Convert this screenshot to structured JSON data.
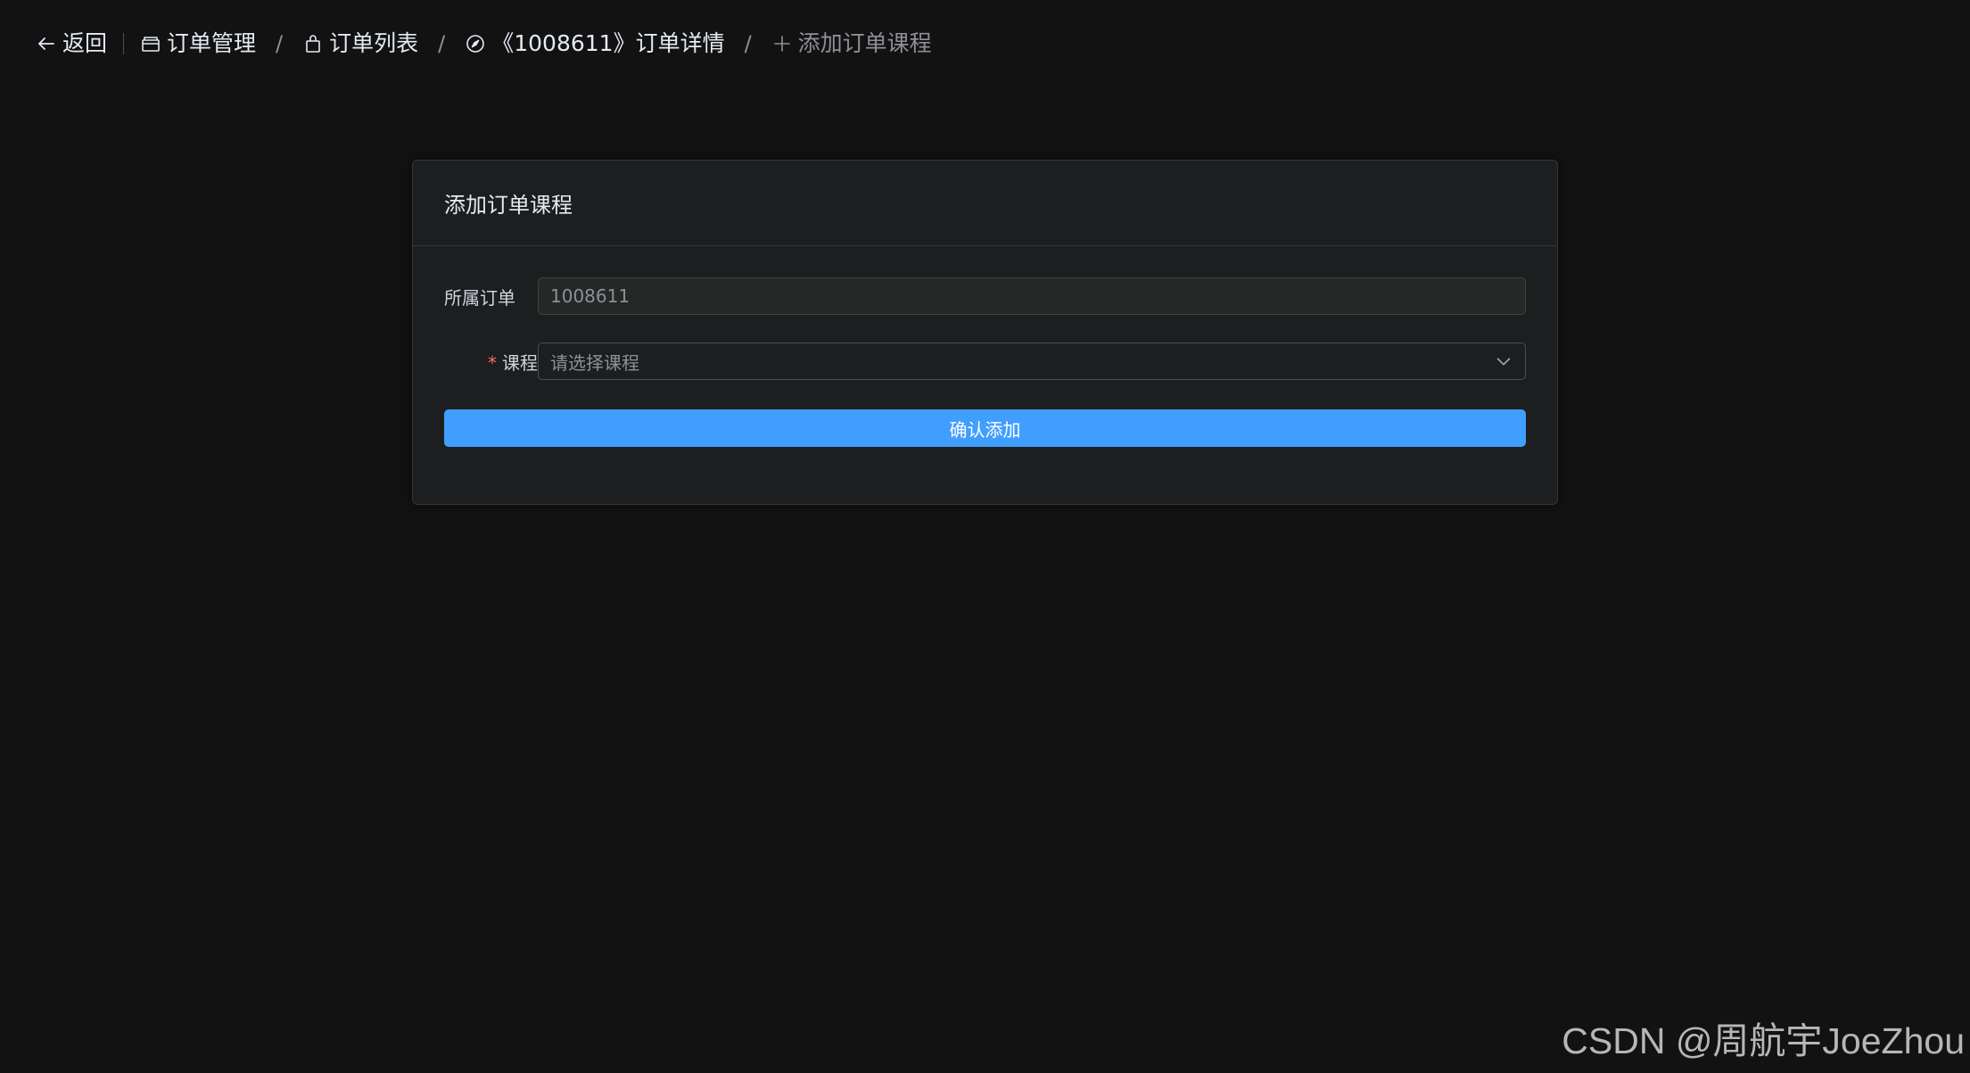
{
  "header": {
    "back_label": "返回",
    "breadcrumbs": [
      {
        "label": "订单管理",
        "icon": "box-icon"
      },
      {
        "label": "订单列表",
        "icon": "shopping-bag-icon"
      },
      {
        "label": "《1008611》订单详情",
        "icon": "compass-icon"
      },
      {
        "label": "添加订单课程",
        "icon": "plus-icon"
      }
    ],
    "separator": "/"
  },
  "card": {
    "title": "添加订单课程",
    "form": {
      "order_label": "所属订单",
      "order_value": "1008611",
      "course_required_mark": "*",
      "course_label": "课程",
      "course_placeholder": "请选择课程"
    },
    "submit_label": "确认添加"
  },
  "watermark": "CSDN @周航宇JoeZhou",
  "colors": {
    "background": "#121213",
    "card_background": "#1d1e1f",
    "primary": "#409eff",
    "required": "#f56c6c"
  }
}
